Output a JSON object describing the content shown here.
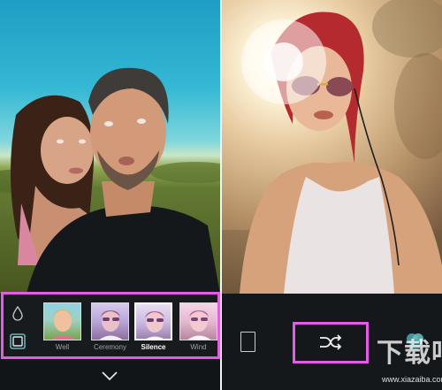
{
  "left_screen": {
    "tools": [
      {
        "icon": "droplet-icon"
      },
      {
        "icon": "frame-icon"
      }
    ],
    "filters": [
      {
        "label": "Well",
        "selected": false
      },
      {
        "label": "Ceremony",
        "selected": false
      },
      {
        "label": "Silence",
        "selected": true
      },
      {
        "label": "Wind",
        "selected": false
      }
    ],
    "nav": {
      "icon": "chevron-down-icon"
    }
  },
  "right_screen": {
    "actions": [
      {
        "icon": "frame-icon"
      },
      {
        "icon": "shuffle-icon"
      },
      {
        "icon": "overlapping-circles-icon"
      }
    ]
  },
  "watermark": {
    "logo": "下载吧",
    "url": "www.xiazaiba.com"
  },
  "colors": {
    "highlight": "#e65be6",
    "bar_bg": "#181b1e",
    "label_muted": "#9ba2a8",
    "label_active": "#ffffff"
  }
}
